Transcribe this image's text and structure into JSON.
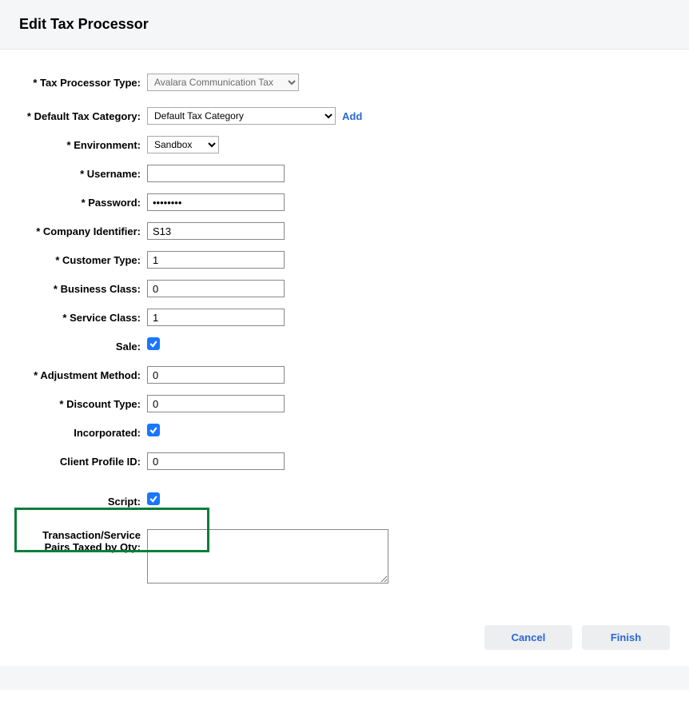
{
  "header": {
    "title": "Edit Tax Processor"
  },
  "labels": {
    "processor_type": "Tax Processor Type:",
    "default_category": "Default Tax Category:",
    "environment": "Environment:",
    "username": "Username:",
    "password": "Password:",
    "company_identifier": "Company Identifier:",
    "customer_type": "Customer Type:",
    "business_class": "Business Class:",
    "service_class": "Service Class:",
    "sale": "Sale:",
    "adjustment_method": "Adjustment Method:",
    "discount_type": "Discount Type:",
    "incorporated": "Incorporated:",
    "client_profile_id": "Client Profile ID:",
    "script": "Script:",
    "pairs": "Transaction/Service Pairs Taxed by Qty:"
  },
  "values": {
    "processor_type": "Avalara Communication Tax",
    "default_category": "Default Tax Category",
    "environment": "Sandbox",
    "username": "",
    "password": "••••••••",
    "company_identifier": "S13",
    "customer_type": "1",
    "business_class": "0",
    "service_class": "1",
    "adjustment_method": "0",
    "discount_type": "0",
    "client_profile_id": "0",
    "pairs": ""
  },
  "checks": {
    "sale": true,
    "incorporated": true,
    "script": true
  },
  "actions": {
    "add": "Add",
    "cancel": "Cancel",
    "finish": "Finish"
  }
}
